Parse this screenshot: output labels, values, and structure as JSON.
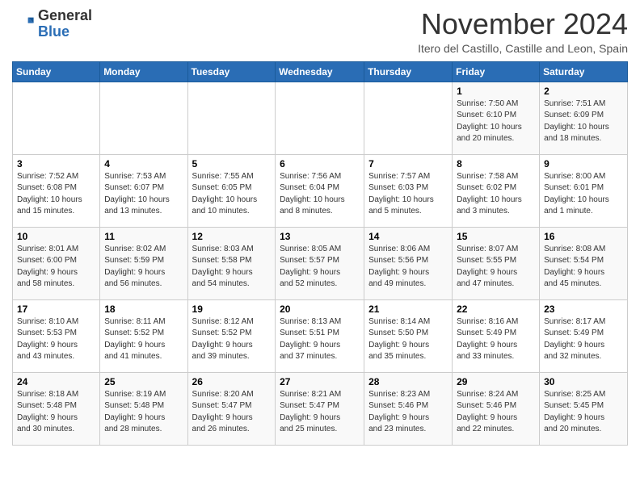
{
  "header": {
    "logo_line1": "General",
    "logo_line2": "Blue",
    "month": "November 2024",
    "location": "Itero del Castillo, Castille and Leon, Spain"
  },
  "weekdays": [
    "Sunday",
    "Monday",
    "Tuesday",
    "Wednesday",
    "Thursday",
    "Friday",
    "Saturday"
  ],
  "weeks": [
    [
      {
        "day": "",
        "info": ""
      },
      {
        "day": "",
        "info": ""
      },
      {
        "day": "",
        "info": ""
      },
      {
        "day": "",
        "info": ""
      },
      {
        "day": "",
        "info": ""
      },
      {
        "day": "1",
        "info": "Sunrise: 7:50 AM\nSunset: 6:10 PM\nDaylight: 10 hours\nand 20 minutes."
      },
      {
        "day": "2",
        "info": "Sunrise: 7:51 AM\nSunset: 6:09 PM\nDaylight: 10 hours\nand 18 minutes."
      }
    ],
    [
      {
        "day": "3",
        "info": "Sunrise: 7:52 AM\nSunset: 6:08 PM\nDaylight: 10 hours\nand 15 minutes."
      },
      {
        "day": "4",
        "info": "Sunrise: 7:53 AM\nSunset: 6:07 PM\nDaylight: 10 hours\nand 13 minutes."
      },
      {
        "day": "5",
        "info": "Sunrise: 7:55 AM\nSunset: 6:05 PM\nDaylight: 10 hours\nand 10 minutes."
      },
      {
        "day": "6",
        "info": "Sunrise: 7:56 AM\nSunset: 6:04 PM\nDaylight: 10 hours\nand 8 minutes."
      },
      {
        "day": "7",
        "info": "Sunrise: 7:57 AM\nSunset: 6:03 PM\nDaylight: 10 hours\nand 5 minutes."
      },
      {
        "day": "8",
        "info": "Sunrise: 7:58 AM\nSunset: 6:02 PM\nDaylight: 10 hours\nand 3 minutes."
      },
      {
        "day": "9",
        "info": "Sunrise: 8:00 AM\nSunset: 6:01 PM\nDaylight: 10 hours\nand 1 minute."
      }
    ],
    [
      {
        "day": "10",
        "info": "Sunrise: 8:01 AM\nSunset: 6:00 PM\nDaylight: 9 hours\nand 58 minutes."
      },
      {
        "day": "11",
        "info": "Sunrise: 8:02 AM\nSunset: 5:59 PM\nDaylight: 9 hours\nand 56 minutes."
      },
      {
        "day": "12",
        "info": "Sunrise: 8:03 AM\nSunset: 5:58 PM\nDaylight: 9 hours\nand 54 minutes."
      },
      {
        "day": "13",
        "info": "Sunrise: 8:05 AM\nSunset: 5:57 PM\nDaylight: 9 hours\nand 52 minutes."
      },
      {
        "day": "14",
        "info": "Sunrise: 8:06 AM\nSunset: 5:56 PM\nDaylight: 9 hours\nand 49 minutes."
      },
      {
        "day": "15",
        "info": "Sunrise: 8:07 AM\nSunset: 5:55 PM\nDaylight: 9 hours\nand 47 minutes."
      },
      {
        "day": "16",
        "info": "Sunrise: 8:08 AM\nSunset: 5:54 PM\nDaylight: 9 hours\nand 45 minutes."
      }
    ],
    [
      {
        "day": "17",
        "info": "Sunrise: 8:10 AM\nSunset: 5:53 PM\nDaylight: 9 hours\nand 43 minutes."
      },
      {
        "day": "18",
        "info": "Sunrise: 8:11 AM\nSunset: 5:52 PM\nDaylight: 9 hours\nand 41 minutes."
      },
      {
        "day": "19",
        "info": "Sunrise: 8:12 AM\nSunset: 5:52 PM\nDaylight: 9 hours\nand 39 minutes."
      },
      {
        "day": "20",
        "info": "Sunrise: 8:13 AM\nSunset: 5:51 PM\nDaylight: 9 hours\nand 37 minutes."
      },
      {
        "day": "21",
        "info": "Sunrise: 8:14 AM\nSunset: 5:50 PM\nDaylight: 9 hours\nand 35 minutes."
      },
      {
        "day": "22",
        "info": "Sunrise: 8:16 AM\nSunset: 5:49 PM\nDaylight: 9 hours\nand 33 minutes."
      },
      {
        "day": "23",
        "info": "Sunrise: 8:17 AM\nSunset: 5:49 PM\nDaylight: 9 hours\nand 32 minutes."
      }
    ],
    [
      {
        "day": "24",
        "info": "Sunrise: 8:18 AM\nSunset: 5:48 PM\nDaylight: 9 hours\nand 30 minutes."
      },
      {
        "day": "25",
        "info": "Sunrise: 8:19 AM\nSunset: 5:48 PM\nDaylight: 9 hours\nand 28 minutes."
      },
      {
        "day": "26",
        "info": "Sunrise: 8:20 AM\nSunset: 5:47 PM\nDaylight: 9 hours\nand 26 minutes."
      },
      {
        "day": "27",
        "info": "Sunrise: 8:21 AM\nSunset: 5:47 PM\nDaylight: 9 hours\nand 25 minutes."
      },
      {
        "day": "28",
        "info": "Sunrise: 8:23 AM\nSunset: 5:46 PM\nDaylight: 9 hours\nand 23 minutes."
      },
      {
        "day": "29",
        "info": "Sunrise: 8:24 AM\nSunset: 5:46 PM\nDaylight: 9 hours\nand 22 minutes."
      },
      {
        "day": "30",
        "info": "Sunrise: 8:25 AM\nSunset: 5:45 PM\nDaylight: 9 hours\nand 20 minutes."
      }
    ]
  ]
}
